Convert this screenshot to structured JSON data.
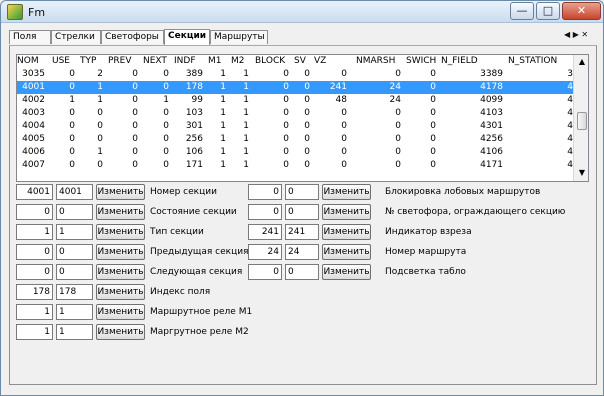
{
  "window": {
    "title": "Fm"
  },
  "tabs": [
    {
      "label": "Поля"
    },
    {
      "label": "Стрелки"
    },
    {
      "label": "Светофоры"
    },
    {
      "label": "Секции"
    },
    {
      "label": "Маршруты"
    }
  ],
  "tab_navigation": {
    "prev": "◀",
    "next": "▶",
    "close": "✕"
  },
  "table": {
    "columns": [
      "NOM",
      "USE",
      "TYP",
      "PREV",
      "NEXT",
      "INDF",
      "M1",
      "M2",
      "BLOCK",
      "SV",
      "VZ",
      "NMARSH",
      "SWICH",
      "N_FIELD",
      "N_STATION"
    ],
    "rows": [
      [
        "3035",
        "0",
        "2",
        "0",
        "0",
        "389",
        "1",
        "1",
        "0",
        "0",
        "0",
        "0",
        "0",
        "3389",
        "3"
      ],
      [
        "4001",
        "0",
        "1",
        "0",
        "0",
        "178",
        "1",
        "1",
        "0",
        "0",
        "241",
        "24",
        "0",
        "4178",
        "4"
      ],
      [
        "4002",
        "1",
        "1",
        "0",
        "1",
        "99",
        "1",
        "1",
        "0",
        "0",
        "48",
        "24",
        "0",
        "4099",
        "4"
      ],
      [
        "4003",
        "0",
        "0",
        "0",
        "0",
        "103",
        "1",
        "1",
        "0",
        "0",
        "0",
        "0",
        "0",
        "4103",
        "4"
      ],
      [
        "4004",
        "0",
        "0",
        "0",
        "0",
        "301",
        "1",
        "1",
        "0",
        "0",
        "0",
        "0",
        "0",
        "4301",
        "4"
      ],
      [
        "4005",
        "0",
        "0",
        "0",
        "0",
        "256",
        "1",
        "1",
        "0",
        "0",
        "0",
        "0",
        "0",
        "4256",
        "4"
      ],
      [
        "4006",
        "0",
        "1",
        "0",
        "0",
        "106",
        "1",
        "1",
        "0",
        "0",
        "0",
        "0",
        "0",
        "4106",
        "4"
      ],
      [
        "4007",
        "0",
        "0",
        "0",
        "0",
        "171",
        "1",
        "1",
        "0",
        "0",
        "0",
        "0",
        "0",
        "4171",
        "4"
      ]
    ],
    "selected_row": 1
  },
  "button_label": "Изменить",
  "left_fields": [
    {
      "value": "4001",
      "edit": "4001",
      "label": "Номер секции"
    },
    {
      "value": "0",
      "edit": "0",
      "label": "Состояние секции"
    },
    {
      "value": "1",
      "edit": "1",
      "label": "Тип секции"
    },
    {
      "value": "0",
      "edit": "0",
      "label": "Предыдущая секция"
    },
    {
      "value": "0",
      "edit": "0",
      "label": "Следующая секция"
    },
    {
      "value": "178",
      "edit": "178",
      "label": "Индекс поля"
    },
    {
      "value": "1",
      "edit": "1",
      "label": "Маршрутное реле М1"
    },
    {
      "value": "1",
      "edit": "1",
      "label": "Маргрутное реле М2"
    }
  ],
  "right_fields": [
    {
      "value": "0",
      "edit": "0",
      "label": "Блокировка лобовых маршрутов"
    },
    {
      "value": "0",
      "edit": "0",
      "label": "№ светофора, ограждающего секцию"
    },
    {
      "value": "241",
      "edit": "241",
      "label": "Индикатор взреза"
    },
    {
      "value": "24",
      "edit": "24",
      "label": "Номер маршрута"
    },
    {
      "value": "0",
      "edit": "0",
      "label": "Подсветка табло"
    }
  ]
}
